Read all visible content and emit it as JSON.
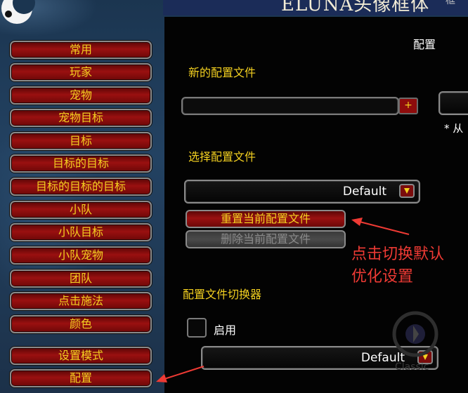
{
  "header": {
    "title": "ELUNA头像框体",
    "right_fragment": "框"
  },
  "sidebar": {
    "items": [
      {
        "label": "常用"
      },
      {
        "label": "玩家"
      },
      {
        "label": "宠物"
      },
      {
        "label": "宠物目标"
      },
      {
        "label": "目标"
      },
      {
        "label": "目标的目标"
      },
      {
        "label": "目标的目标的目标"
      },
      {
        "label": "小队"
      },
      {
        "label": "小队目标"
      },
      {
        "label": "小队宠物"
      },
      {
        "label": "团队"
      },
      {
        "label": "点击施法"
      },
      {
        "label": "颜色"
      },
      {
        "label": "设置模式"
      },
      {
        "label": "配置"
      }
    ]
  },
  "main": {
    "section_title": "配置",
    "new_profile_label": "新的配置文件",
    "new_profile_value": "",
    "add_button": "+",
    "copy_note": "* 从",
    "select_profile_label": "选择配置文件",
    "select_profile_value": "Default",
    "reset_button": "重置当前配置文件",
    "delete_button": "删除当前配置文件",
    "switcher_label": "配置文件切换器",
    "enable_label": "启用",
    "switcher_value": "Default"
  },
  "annotation": {
    "line1": "点击切换默认",
    "line2": "优化设置",
    "color": "#ee3a34"
  },
  "watermark": {
    "text": "Classic"
  },
  "colors": {
    "label_yellow": "#f3d020",
    "button_red": "#9a1010",
    "panel_bg": "#030303"
  }
}
